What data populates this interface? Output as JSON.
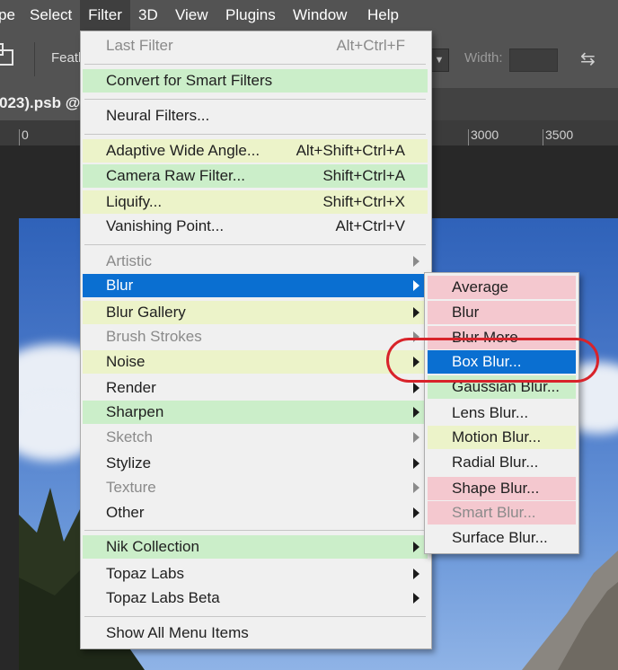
{
  "menubar": {
    "items": [
      {
        "label": "pe"
      },
      {
        "label": "Select"
      },
      {
        "label": "Filter"
      },
      {
        "label": "3D"
      },
      {
        "label": "View"
      },
      {
        "label": "Plugins"
      },
      {
        "label": "Window"
      },
      {
        "label": "Help"
      }
    ]
  },
  "options_bar": {
    "feather_label": "Feath",
    "width_label": "Width:",
    "icons": [
      "selection-mode-icon",
      "chevron-down-icon",
      "swap-icon"
    ]
  },
  "document_tab": {
    "label": "023).psb @"
  },
  "ruler": {
    "labels": [
      "0",
      "3000",
      "3500"
    ]
  },
  "filter_menu": {
    "items": [
      {
        "label": "Last Filter",
        "shortcut": "Alt+Ctrl+F",
        "state": "disabled"
      },
      {
        "label": "Convert for Smart Filters",
        "state": "highlight-green"
      },
      {
        "label": "Neural Filters...",
        "state": "normal"
      },
      {
        "label": "Adaptive Wide Angle...",
        "shortcut": "Alt+Shift+Ctrl+A",
        "state": "highlight-yellow"
      },
      {
        "label": "Camera Raw Filter...",
        "shortcut": "Shift+Ctrl+A",
        "state": "highlight-green"
      },
      {
        "label": "Liquify...",
        "shortcut": "Shift+Ctrl+X",
        "state": "highlight-yellow"
      },
      {
        "label": "Vanishing Point...",
        "shortcut": "Alt+Ctrl+V",
        "state": "normal"
      },
      {
        "label": "Artistic",
        "state": "disabled",
        "submenu": true
      },
      {
        "label": "Blur",
        "state": "selected",
        "submenu": true
      },
      {
        "label": "Blur Gallery",
        "state": "highlight-yellow",
        "submenu": true
      },
      {
        "label": "Brush Strokes",
        "state": "disabled",
        "submenu": true
      },
      {
        "label": "Noise",
        "state": "highlight-yellow",
        "submenu": true
      },
      {
        "label": "Render",
        "state": "normal",
        "submenu": true
      },
      {
        "label": "Sharpen",
        "state": "highlight-green",
        "submenu": true
      },
      {
        "label": "Sketch",
        "state": "disabled",
        "submenu": true
      },
      {
        "label": "Stylize",
        "state": "normal",
        "submenu": true
      },
      {
        "label": "Texture",
        "state": "disabled",
        "submenu": true
      },
      {
        "label": "Other",
        "state": "normal",
        "submenu": true
      },
      {
        "label": "Nik Collection",
        "state": "highlight-green",
        "submenu": true
      },
      {
        "label": "Topaz Labs",
        "state": "normal",
        "submenu": true
      },
      {
        "label": "Topaz Labs Beta",
        "state": "normal",
        "submenu": true
      },
      {
        "label": "Show All Menu Items",
        "state": "normal"
      }
    ]
  },
  "blur_submenu": {
    "items": [
      {
        "label": "Average",
        "state": "highlight-pink"
      },
      {
        "label": "Blur",
        "state": "highlight-pink"
      },
      {
        "label": "Blur More",
        "state": "highlight-pink"
      },
      {
        "label": "Box Blur...",
        "state": "selected"
      },
      {
        "label": "Gaussian Blur...",
        "state": "highlight-green"
      },
      {
        "label": "Lens Blur...",
        "state": "normal"
      },
      {
        "label": "Motion Blur...",
        "state": "highlight-yellow"
      },
      {
        "label": "Radial Blur...",
        "state": "normal"
      },
      {
        "label": "Shape Blur...",
        "state": "highlight-pink"
      },
      {
        "label": "Smart Blur...",
        "state": "disabled-pink"
      },
      {
        "label": "Surface Blur...",
        "state": "normal"
      }
    ]
  },
  "colors": {
    "menubar_bg": "#535353",
    "menu_bg": "#f0f0f0",
    "selection_blue": "#0a6fd1",
    "highlight_green": "#cbeec9",
    "highlight_yellow": "#ecf3c9",
    "highlight_pink": "#f4c8cf",
    "annotation_red": "#d8232a"
  }
}
